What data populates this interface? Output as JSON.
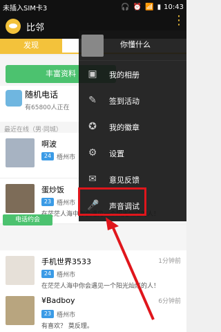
{
  "status": {
    "carrier": "未插入SIM卡3",
    "time": "10:43"
  },
  "app": {
    "title": "比邻"
  },
  "tabs": {
    "discover": "发现"
  },
  "content": {
    "green_button": "丰富资料",
    "random_call_title": "随机电话",
    "random_call_sub": "有65800人正在",
    "recent_label": "最近在线（男·同城）"
  },
  "users": [
    {
      "name": "啊波",
      "age": "24",
      "city": "梧州市",
      "bio": "",
      "time": ""
    },
    {
      "name": "蛋炒饭",
      "age": "23",
      "city": "梧州市",
      "bio": "在茫茫人海中你会遇见一个阳光灿烂的人！",
      "time": "",
      "chips": [
        "电话约会"
      ]
    },
    {
      "name": "手机世界3533",
      "age": "24",
      "city": "梧州市",
      "bio": "在茫茫人海中你会遇见一个阳光灿烂的人！",
      "time": "1分钟前"
    },
    {
      "name": "¥Badboy",
      "age": "23",
      "city": "梧州市",
      "bio": "有喜欢？ 莫反理。",
      "time": "6分钟前"
    }
  ],
  "menu": {
    "username": "你懂什么",
    "items": [
      {
        "label": "我的相册",
        "icon": "image-icon"
      },
      {
        "label": "签到活动",
        "icon": "pencil-icon"
      },
      {
        "label": "我的徽章",
        "icon": "medal-icon"
      },
      {
        "label": "设置",
        "icon": "gear-icon"
      },
      {
        "label": "意见反馈",
        "icon": "mail-icon"
      },
      {
        "label": "声音调试",
        "icon": "microphone-icon"
      }
    ]
  },
  "colors": {
    "accent": "#f3c23b",
    "green": "#4cc26f",
    "highlight": "#e0161c"
  }
}
